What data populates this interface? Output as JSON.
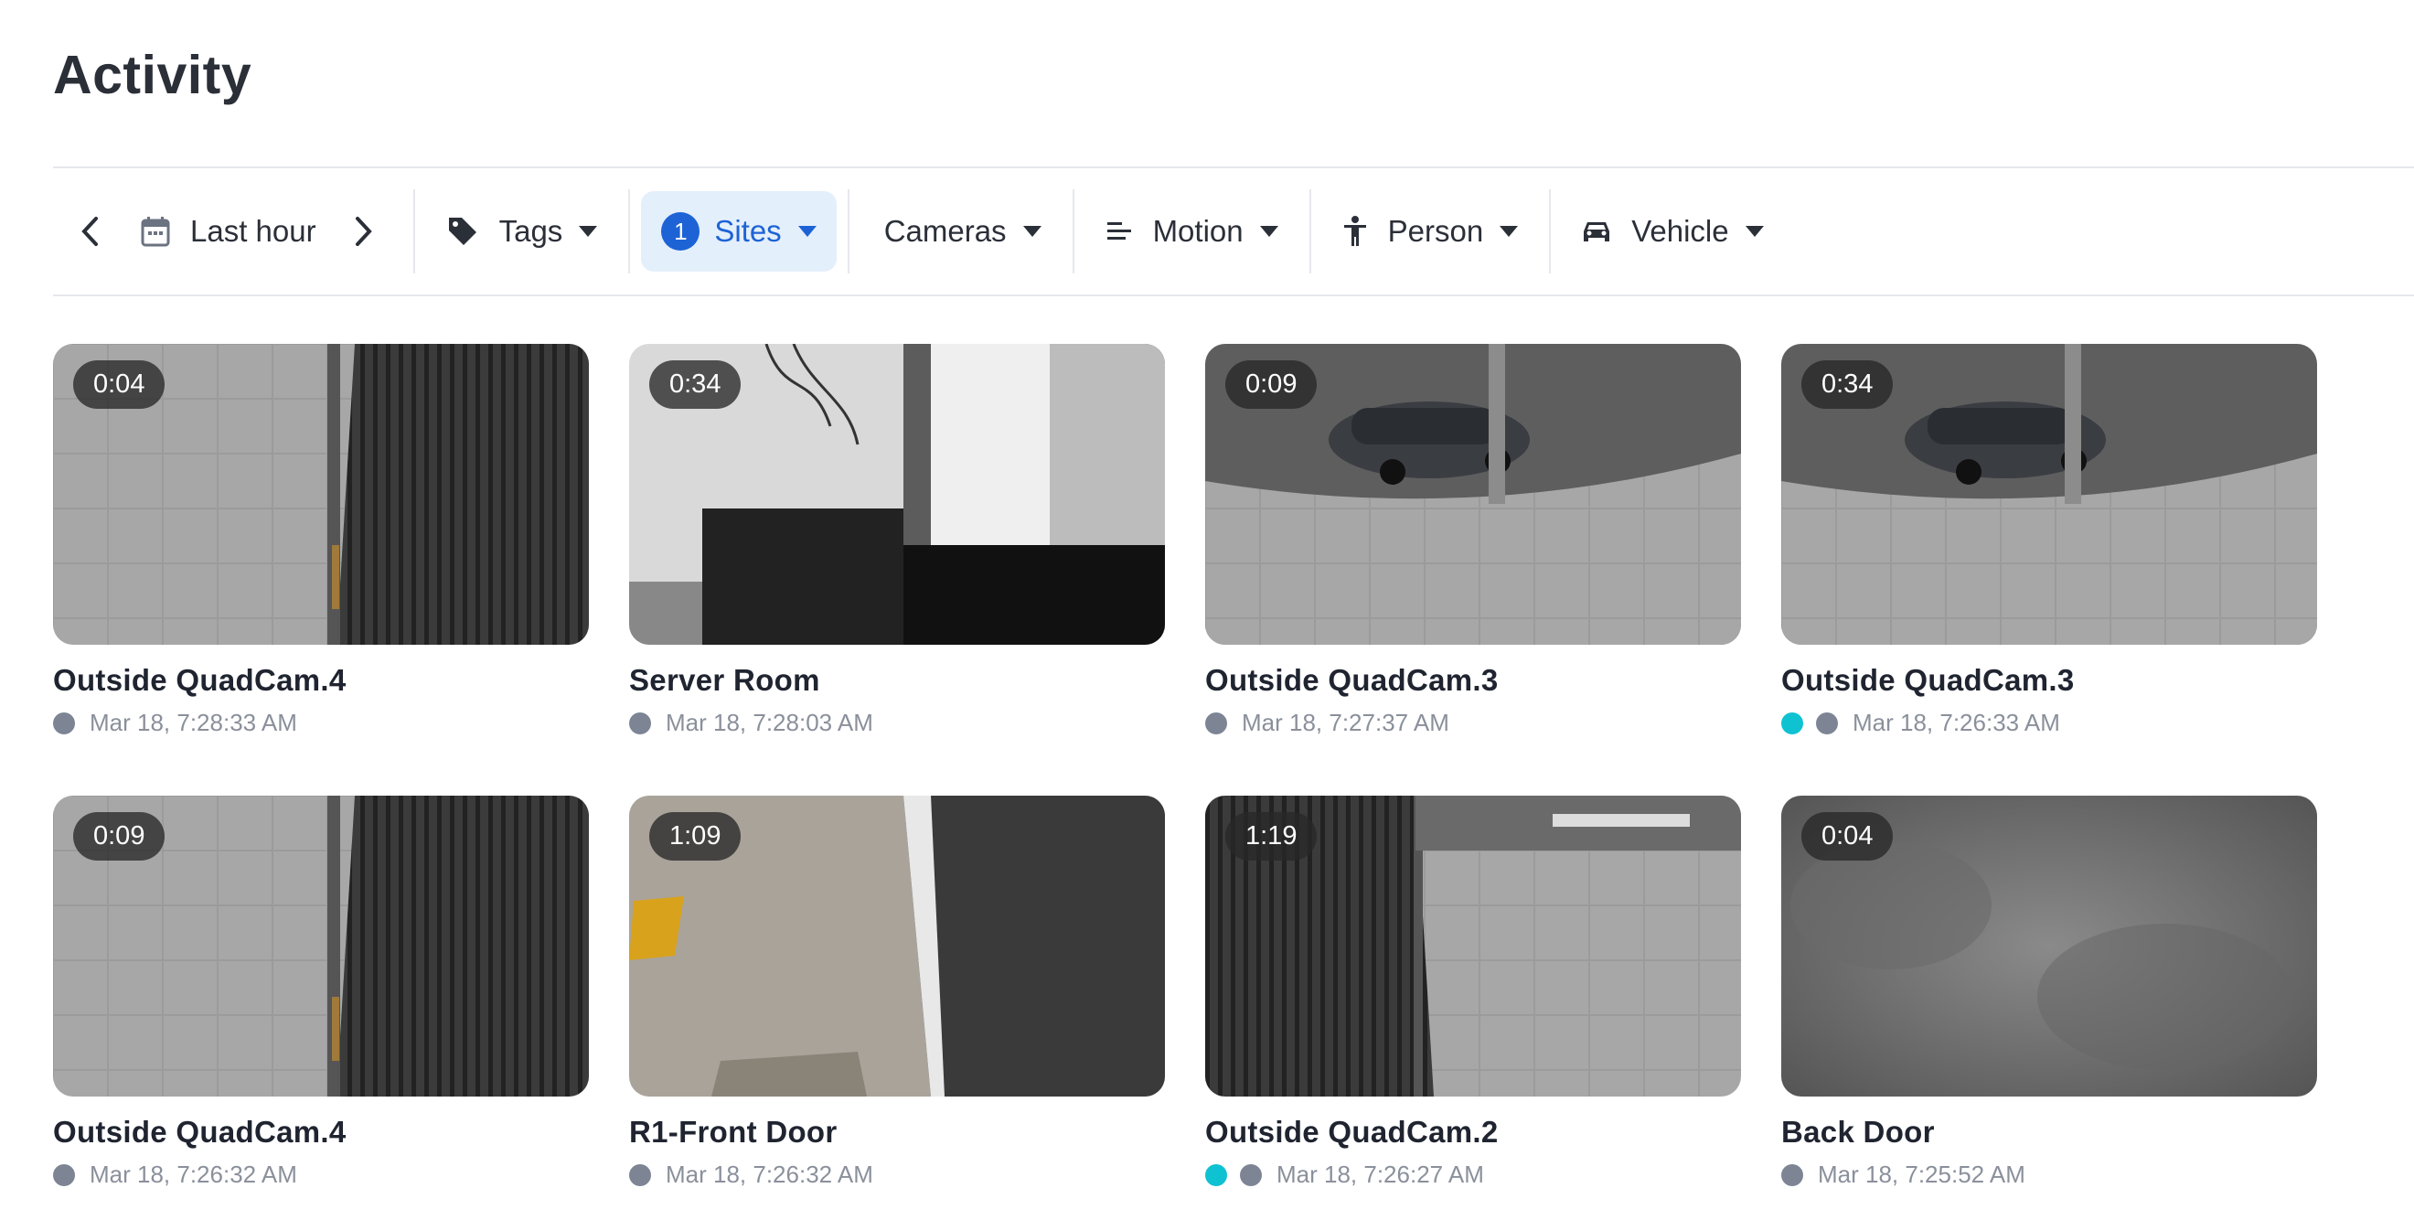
{
  "page": {
    "title": "Activity"
  },
  "toolbar": {
    "date_range": "Last hour",
    "tags_label": "Tags",
    "sites_label": "Sites",
    "sites_count": "1",
    "cameras_label": "Cameras",
    "motion_label": "Motion",
    "person_label": "Person",
    "vehicle_label": "Vehicle"
  },
  "clips": [
    {
      "duration": "0:04",
      "camera": "Outside QuadCam.4",
      "timestamp": "Mar 18, 7:28:33 AM",
      "scene": "sidewalk-shutter",
      "teal_dot": false
    },
    {
      "duration": "0:34",
      "camera": "Server Room",
      "timestamp": "Mar 18, 7:28:03 AM",
      "scene": "server-room",
      "teal_dot": false
    },
    {
      "duration": "0:09",
      "camera": "Outside QuadCam.3",
      "timestamp": "Mar 18, 7:27:37 AM",
      "scene": "street-car",
      "teal_dot": false
    },
    {
      "duration": "0:34",
      "camera": "Outside QuadCam.3",
      "timestamp": "Mar 18, 7:26:33 AM",
      "scene": "street-car",
      "teal_dot": true
    },
    {
      "duration": "0:09",
      "camera": "Outside QuadCam.4",
      "timestamp": "Mar 18, 7:26:32 AM",
      "scene": "sidewalk-shutter",
      "teal_dot": false
    },
    {
      "duration": "1:09",
      "camera": "R1-Front Door",
      "timestamp": "Mar 18, 7:26:32 AM",
      "scene": "front-door",
      "teal_dot": false
    },
    {
      "duration": "1:19",
      "camera": "Outside QuadCam.2",
      "timestamp": "Mar 18, 7:26:27 AM",
      "scene": "sidewalk-corner",
      "teal_dot": true
    },
    {
      "duration": "0:04",
      "camera": "Back Door",
      "timestamp": "Mar 18, 7:25:52 AM",
      "scene": "foggy",
      "teal_dot": false
    }
  ],
  "colors": {
    "accent": "#1d63d6",
    "accent_bg": "#e4effc",
    "teal": "#0fc2d2",
    "grey_dot": "#7d8595"
  }
}
